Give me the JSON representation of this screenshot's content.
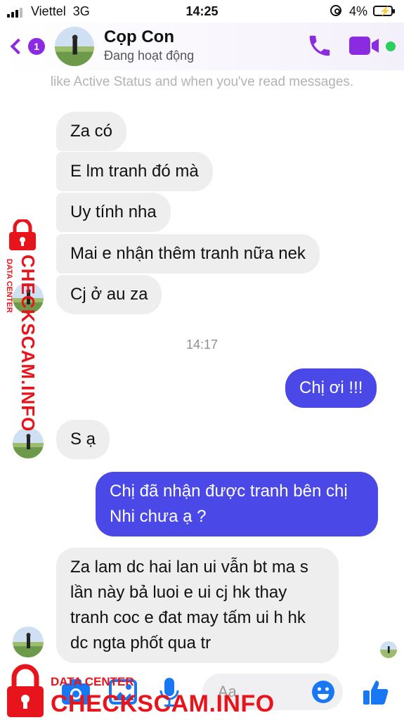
{
  "status_bar": {
    "carrier": "Viettel",
    "network": "3G",
    "time": "14:25",
    "battery": "4%"
  },
  "header": {
    "unread_count": "1",
    "contact_name": "Cọp Con",
    "contact_status": "Đang hoạt động"
  },
  "faded_note": "like Active Status and when you've read messages.",
  "messages": [
    {
      "from": "contact",
      "text": "Za có"
    },
    {
      "from": "contact",
      "text": "E lm tranh đó mà"
    },
    {
      "from": "contact",
      "text": "Uy tính nha"
    },
    {
      "from": "contact",
      "text": "Mai e nhận thêm tranh nữa nek"
    },
    {
      "from": "contact",
      "text": "Cj ở au za"
    },
    {
      "from": "me",
      "text": "Chị ơi !!!"
    },
    {
      "from": "contact",
      "text": "S ạ"
    },
    {
      "from": "me",
      "text": "Chị đã nhận được tranh bên chị Nhi chưa ạ ?"
    },
    {
      "from": "contact",
      "text": "Za lam dc hai lan ui vẫn bt ma s lần này bả luoi e ui cj hk thay tranh coc e đat may tấm ui h hk dc ngta phốt qua tr"
    }
  ],
  "time_separator": "14:17",
  "composer": {
    "placeholder": "Aa"
  },
  "watermark": {
    "sub": "DATA CENTER",
    "site": "CHECKSCAM.INFO"
  },
  "colors": {
    "accent": "#8a2be2",
    "outgoing_bubble": "#4a49e8",
    "incoming_bubble": "#eeeeef",
    "watermark": "#e8141c",
    "online": "#2bd05c"
  },
  "icons": [
    "back-chevron-icon",
    "phone-icon",
    "video-camera-icon",
    "camera-icon",
    "image-icon",
    "microphone-icon",
    "emoji-icon",
    "thumbs-up-icon",
    "lock-icon"
  ]
}
